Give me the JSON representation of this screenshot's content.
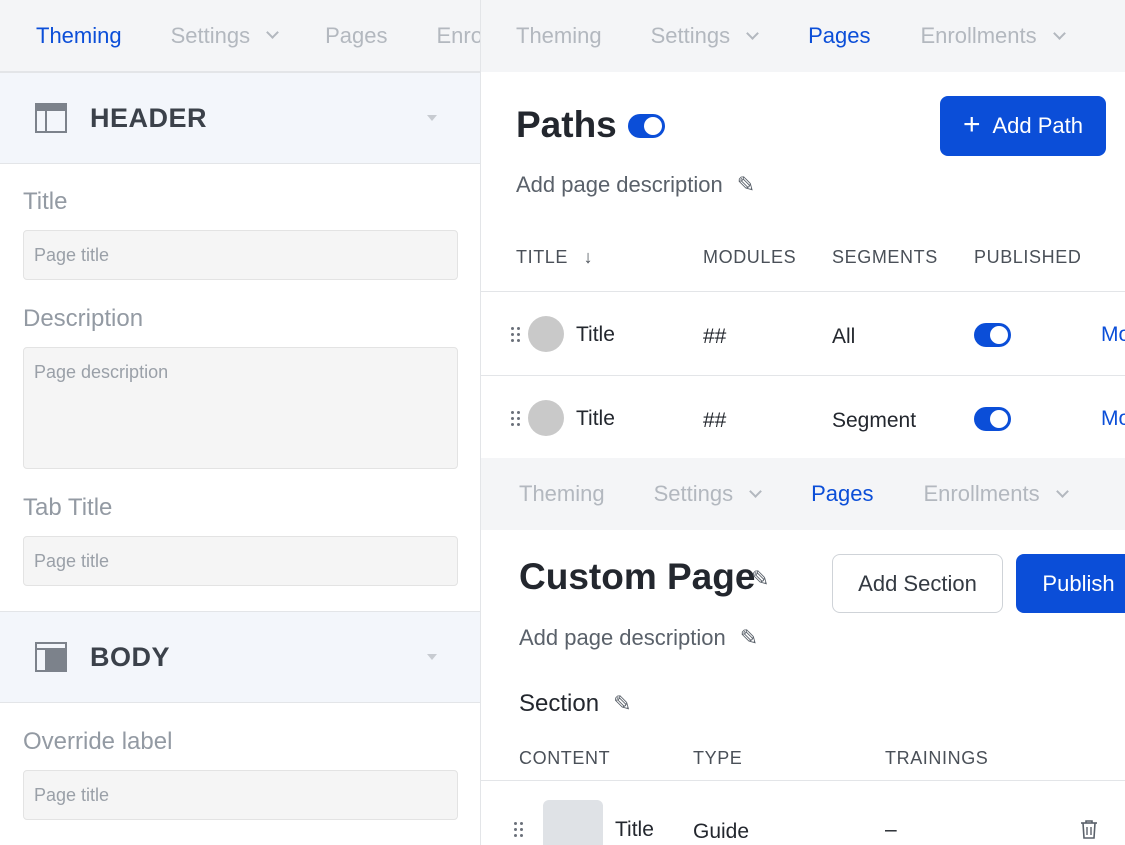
{
  "left_panel": {
    "tabs": [
      {
        "label": "Theming",
        "active": true
      },
      {
        "label": "Settings",
        "active": false,
        "dropdown": true
      },
      {
        "label": "Pages",
        "active": false
      },
      {
        "label": "Enrollments",
        "active": false
      }
    ],
    "header_section": {
      "title": "HEADER",
      "icon": "layout-header-icon",
      "fields": [
        {
          "label": "Title",
          "placeholder": "Page title"
        },
        {
          "label": "Description",
          "placeholder": "Page description"
        },
        {
          "label": "Tab Title",
          "placeholder": "Page title"
        }
      ]
    },
    "body_section": {
      "title": "BODY",
      "icon": "layout-body-icon",
      "fields": [
        {
          "label": "Override label",
          "placeholder": "Page title"
        }
      ]
    }
  },
  "paths_panel": {
    "tabs": [
      {
        "label": "Theming",
        "active": false
      },
      {
        "label": "Settings",
        "active": false,
        "dropdown": true
      },
      {
        "label": "Pages",
        "active": true
      },
      {
        "label": "Enrollments",
        "active": false,
        "dropdown": true
      }
    ],
    "title": "Paths",
    "title_toggle_on": true,
    "add_button_label": "Add Path",
    "description_placeholder": "Add page description",
    "columns": [
      "TITLE",
      "MODULES",
      "SEGMENTS",
      "PUBLISHED"
    ],
    "rows": [
      {
        "title": "Title",
        "modules": "##",
        "segments": "All",
        "published": true,
        "more": "More"
      },
      {
        "title": "Title",
        "modules": "##",
        "segments": "Segment",
        "published": true,
        "more": "More"
      }
    ]
  },
  "custom_page_panel": {
    "tabs": [
      {
        "label": "Theming",
        "active": false
      },
      {
        "label": "Settings",
        "active": false,
        "dropdown": true
      },
      {
        "label": "Pages",
        "active": true
      },
      {
        "label": "Enrollments",
        "active": false,
        "dropdown": true
      }
    ],
    "title": "Custom Page",
    "add_section_label": "Add Section",
    "publish_label": "Publish",
    "description_placeholder": "Add page description",
    "section_title": "Section",
    "columns": [
      "CONTENT",
      "TYPE",
      "TRAININGS"
    ],
    "rows": [
      {
        "title": "Title",
        "type": "Guide",
        "trainings": "–"
      }
    ]
  },
  "colors": {
    "accent": "#0b4ed8",
    "tabbar_bg": "#f4f5f7",
    "section_bg": "#f3f6fb"
  }
}
